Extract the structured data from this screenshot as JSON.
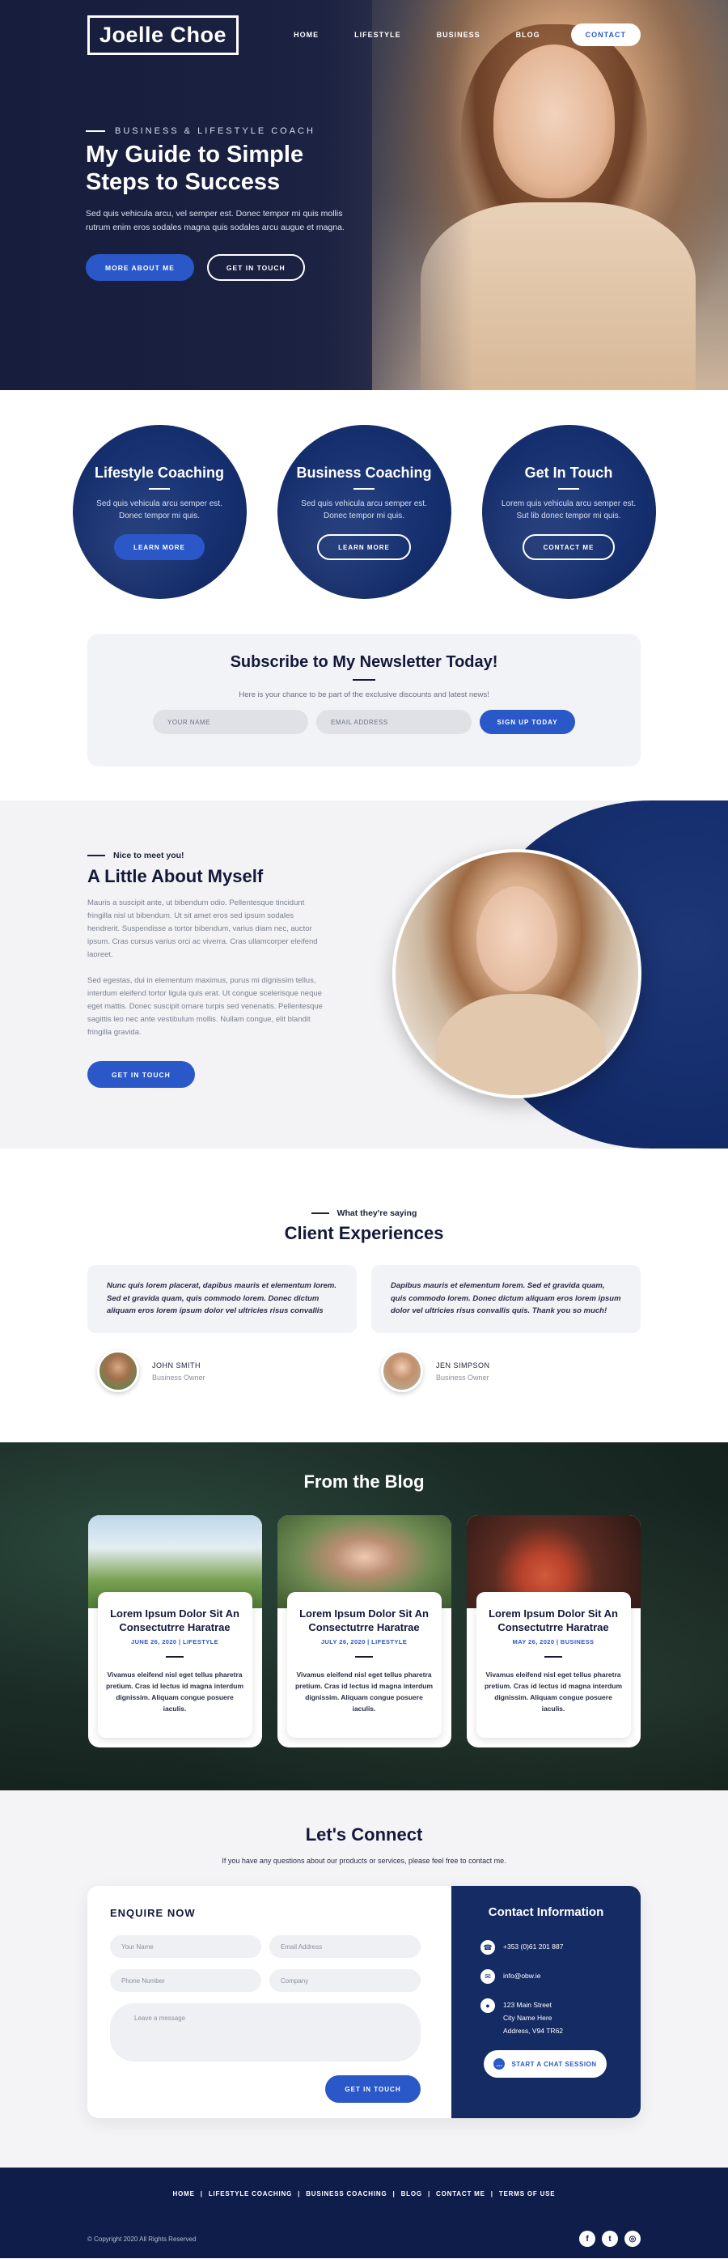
{
  "nav": {
    "logo": "Joelle Choe",
    "links": [
      "HOME",
      "LIFESTYLE",
      "BUSINESS",
      "BLOG"
    ],
    "contact": "CONTACT"
  },
  "hero": {
    "eyebrow": "BUSINESS & LIFESTYLE COACH",
    "title": "My Guide to Simple Steps to Success",
    "text": "Sed quis vehicula arcu, vel semper est. Donec tempor mi quis mollis rutrum enim eros sodales magna quis sodales arcu augue et magna.",
    "btn_primary": "MORE ABOUT ME",
    "btn_secondary": "GET IN TOUCH"
  },
  "services": [
    {
      "title": "Lifestyle Coaching",
      "text": "Sed quis vehicula arcu semper est. Donec tempor mi quis.",
      "button": "LEARN MORE"
    },
    {
      "title": "Business Coaching",
      "text": "Sed quis vehicula arcu semper est. Donec tempor mi quis.",
      "button": "LEARN MORE"
    },
    {
      "title": "Get In Touch",
      "text": "Lorem quis vehicula arcu semper est. Sut lib donec tempor mi quis.",
      "button": "CONTACT ME"
    }
  ],
  "newsletter": {
    "title": "Subscribe to My Newsletter Today!",
    "text": "Here is your chance to be part of the exclusive discounts and latest news!",
    "name_placeholder": "YOUR NAME",
    "email_placeholder": "EMAIL ADDRESS",
    "button": "SIGN UP TODAY"
  },
  "about": {
    "eyebrow": "Nice to meet you!",
    "title": "A Little About Myself",
    "p1": "Mauris a suscipit ante, ut bibendum odio. Pellentesque tincidunt fringilla nisl ut bibendum. Ut sit amet eros sed ipsum sodales hendrerit. Suspendisse a tortor bibendum, varius diam nec, auctor ipsum. Cras cursus varius orci ac viverra. Cras ullamcorper eleifend laoreet.",
    "p2": "Sed egestas, dui in elementum maximus, purus mi dignissim tellus, interdum eleifend tortor ligula quis erat. Ut congue scelerisque neque eget mattis. Donec suscipit ornare turpis sed venenatis. Pellentesque sagittis leo nec ante vestibulum mollis. Nullam congue, elit blandit fringilla gravida.",
    "button": "GET IN TOUCH"
  },
  "testimonials": {
    "eyebrow": "What they're saying",
    "title": "Client Experiences",
    "items": [
      {
        "quote": "Nunc quis lorem placerat, dapibus mauris et elementum lorem. Sed et gravida quam, quis commodo lorem. Donec dictum aliquam eros lorem ipsum dolor vel ultricies risus convallis",
        "name": "JOHN SMITH",
        "role": "Business Owner"
      },
      {
        "quote": "Dapibus mauris et elementum lorem. Sed et gravida quam, quis commodo lorem. Donec dictum aliquam eros lorem ipsum dolor vel ultricies risus convallis quis. Thank you so much!",
        "name": "JEN SIMPSON",
        "role": "Business Owner"
      }
    ]
  },
  "blog": {
    "title": "From the Blog",
    "posts": [
      {
        "title": "Lorem Ipsum Dolor Sit An Consectutrre Haratrae",
        "meta": "JUNE 26, 2020 | LIFESTYLE",
        "text": "Vivamus eleifend nisl eget tellus pharetra pretium. Cras id lectus id magna interdum dignissim. Aliquam congue posuere iaculis."
      },
      {
        "title": "Lorem Ipsum Dolor Sit An Consectutrre Haratrae",
        "meta": "JULY 26, 2020 | LIFESTYLE",
        "text": "Vivamus eleifend nisl eget tellus pharetra pretium. Cras id lectus id magna interdum dignissim. Aliquam congue posuere iaculis."
      },
      {
        "title": "Lorem Ipsum Dolor Sit An Consectutrre Haratrae",
        "meta": "MAY 26, 2020 | BUSINESS",
        "text": "Vivamus eleifend nisl eget tellus pharetra pretium. Cras id lectus id magna interdum dignissim. Aliquam congue posuere iaculis."
      }
    ]
  },
  "connect": {
    "title": "Let's Connect",
    "subtitle": "If you have any questions about our products or services, please feel free to contact me.",
    "form": {
      "title": "ENQUIRE NOW",
      "name_placeholder": "Your Name",
      "email_placeholder": "Email Address",
      "phone_placeholder": "Phone Number",
      "company_placeholder": "Company",
      "message_placeholder": "Leave a message",
      "button": "GET IN TOUCH"
    },
    "info": {
      "title": "Contact Information",
      "phone": "+353 (0)61 201 887",
      "email": "info@obw.ie",
      "address1": "123 Main Street",
      "address2": "City Name Here",
      "address3": "Address, V94 TR62",
      "chat_button": "START A CHAT SESSION"
    }
  },
  "footer": {
    "links": [
      "HOME",
      "LIFESTYLE COACHING",
      "BUSINESS COACHING",
      "BLOG",
      "CONTACT ME",
      "TERMS OF USE"
    ],
    "copyright": "© Copyright 2020 All Rights Reserved"
  },
  "colors": {
    "accent": "#2b58c8",
    "navy": "#142b64",
    "dark_text": "#14183a"
  }
}
